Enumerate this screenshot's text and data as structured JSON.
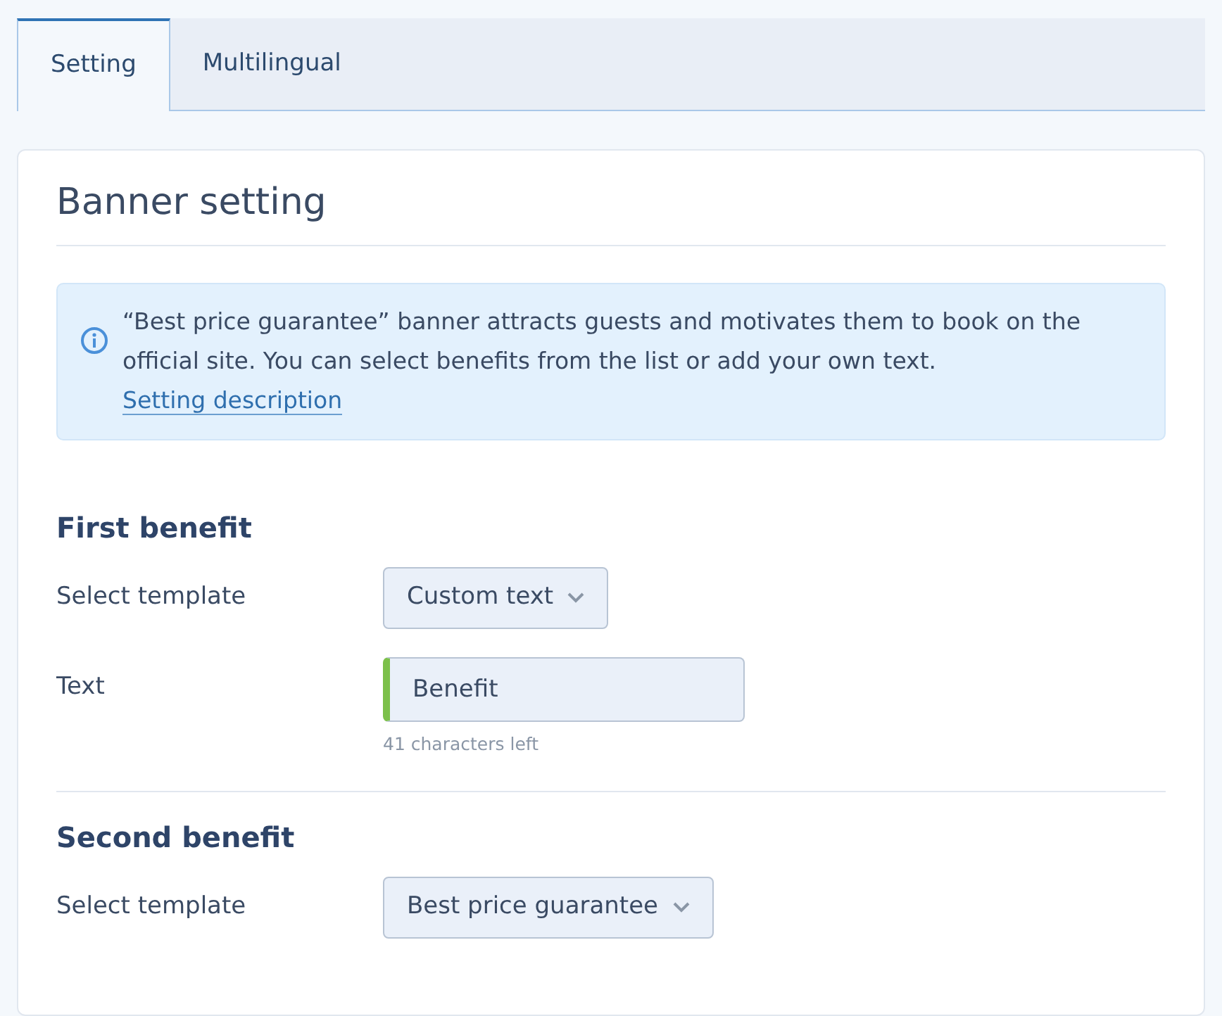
{
  "tabs": [
    {
      "label": "Setting",
      "selected": true
    },
    {
      "label": "Multilingual",
      "selected": false
    }
  ],
  "card": {
    "title": "Banner setting",
    "info": {
      "text": "“Best price guarantee” banner attracts guests and motivates them to book on the official site. You can select benefits from the list or add your own text.",
      "link": "Setting description"
    },
    "sections": [
      {
        "title": "First benefit",
        "fields": [
          {
            "kind": "select",
            "label": "Select template",
            "value": "Custom text"
          },
          {
            "kind": "text",
            "label": "Text",
            "value": "Benefit",
            "valid": true,
            "hint": "41 characters left"
          }
        ]
      },
      {
        "title": "Second benefit",
        "fields": [
          {
            "kind": "select",
            "label": "Select template",
            "value": "Best price guarantee"
          }
        ]
      }
    ]
  }
}
